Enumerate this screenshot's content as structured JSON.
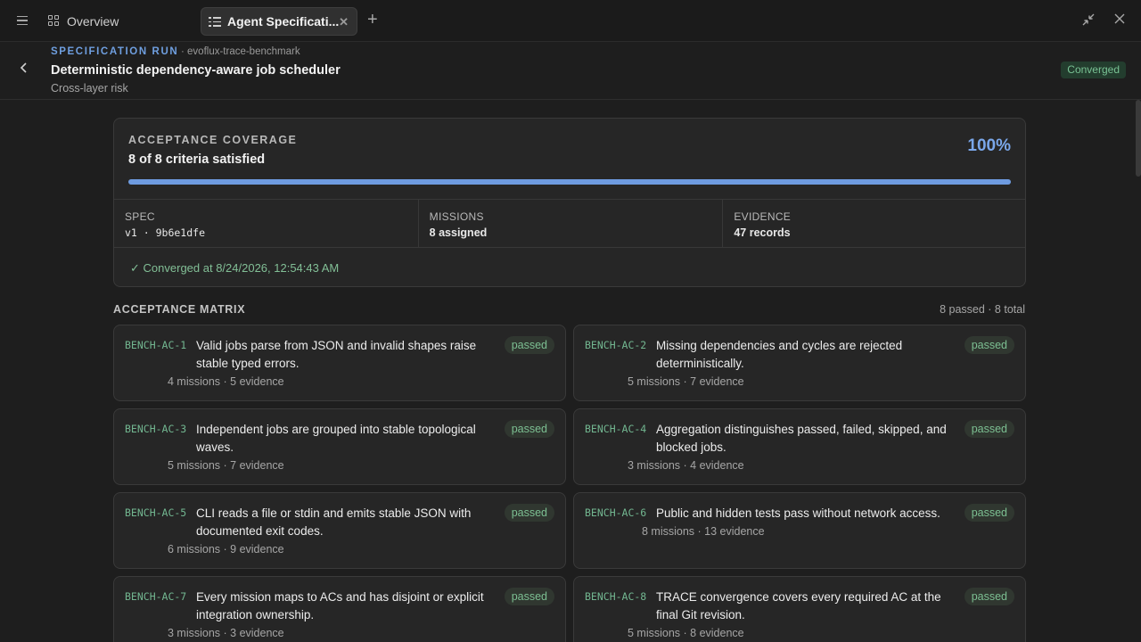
{
  "tabbar": {
    "tabs": [
      {
        "label": "Overview",
        "icon": "grid-icon"
      },
      {
        "label": "Agent Specificati...",
        "icon": "checklist-icon"
      }
    ]
  },
  "header": {
    "run_label": "SPECIFICATION RUN",
    "run_source": "· evoflux-trace-benchmark",
    "title": "Deterministic dependency-aware job scheduler",
    "subtitle": "Cross-layer risk",
    "status_badge": "Converged"
  },
  "coverage": {
    "title": "ACCEPTANCE COVERAGE",
    "summary": "8 of 8 criteria satisfied",
    "percent_label": "100%",
    "progress": 1.0,
    "stats": [
      {
        "label": "SPEC",
        "value": "v1 · 9b6e1dfe"
      },
      {
        "label": "MISSIONS",
        "value": "8 assigned"
      },
      {
        "label": "EVIDENCE",
        "value": "47 records"
      }
    ],
    "converged_text": "Converged at 8/24/2026, 12:54:43 AM"
  },
  "matrix": {
    "title": "ACCEPTANCE MATRIX",
    "count": "8 passed · 8 total",
    "items": [
      {
        "id": "BENCH-AC-1",
        "text": "Valid jobs parse from JSON and invalid shapes raise stable typed errors.",
        "meta": "4 missions · 5 evidence",
        "status": "passed"
      },
      {
        "id": "BENCH-AC-2",
        "text": "Missing dependencies and cycles are rejected deterministically.",
        "meta": "5 missions · 7 evidence",
        "status": "passed"
      },
      {
        "id": "BENCH-AC-3",
        "text": "Independent jobs are grouped into stable topological waves.",
        "meta": "5 missions · 7 evidence",
        "status": "passed"
      },
      {
        "id": "BENCH-AC-4",
        "text": "Aggregation distinguishes passed, failed, skipped, and blocked jobs.",
        "meta": "3 missions · 4 evidence",
        "status": "passed"
      },
      {
        "id": "BENCH-AC-5",
        "text": "CLI reads a file or stdin and emits stable JSON with documented exit codes.",
        "meta": "6 missions · 9 evidence",
        "status": "passed"
      },
      {
        "id": "BENCH-AC-6",
        "text": "Public and hidden tests pass without network access.",
        "meta": "8 missions · 13 evidence",
        "status": "passed"
      },
      {
        "id": "BENCH-AC-7",
        "text": "Every mission maps to ACs and has disjoint or explicit integration ownership.",
        "meta": "3 missions · 3 evidence",
        "status": "passed"
      },
      {
        "id": "BENCH-AC-8",
        "text": "TRACE convergence covers every required AC at the final Git revision.",
        "meta": "5 missions · 8 evidence",
        "status": "passed"
      }
    ]
  }
}
